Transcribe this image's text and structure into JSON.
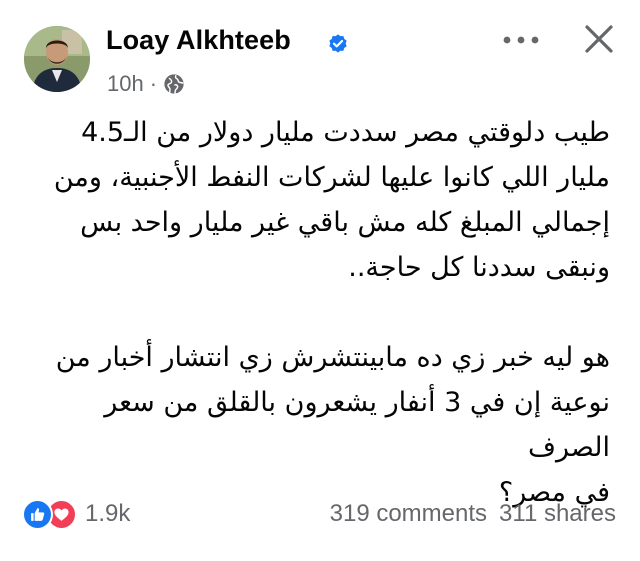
{
  "post": {
    "author": {
      "name": "Loay Alkhteeb",
      "verified": true
    },
    "time": "10h",
    "separator": "·",
    "audience_icon": "globe-icon",
    "body_paragraphs": [
      "طيب دلوقتي مصر سددت مليار دولار من الـ4.5\nمليار اللي كانوا عليها لشركات النفط الأجنبية، ومن\nإجمالي المبلغ كله مش باقي غير مليار واحد بس\nونبقى سددنا كل حاجة..",
      "هو ليه خبر زي ده مابينتشرش زي انتشار أخبار من\nنوعية إن في 3 أنفار يشعرون بالقلق من سعر الصرف\nفي مصر؟"
    ]
  },
  "actions": {
    "more_icon": "more-horizontal-icon",
    "close_icon": "close-icon"
  },
  "footer": {
    "reactions_count": "1.9k",
    "reaction_icons": [
      "like-icon",
      "love-icon"
    ],
    "comments": "319 comments",
    "shares": "311 shares"
  },
  "colors": {
    "verified_blue": "#1877f2",
    "like_blue": "#1877f2",
    "love_red": "#f33e58",
    "meta_gray": "#65676b",
    "text": "#050505"
  }
}
